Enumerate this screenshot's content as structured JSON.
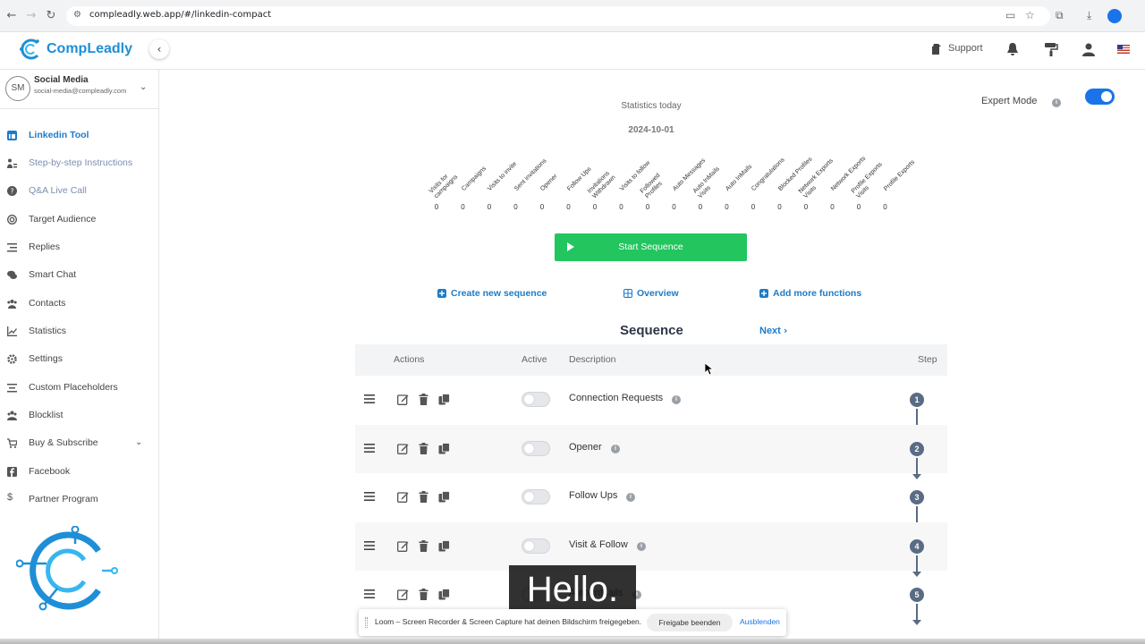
{
  "browser": {
    "url": "compleadly.web.app/#/linkedin-compact"
  },
  "header": {
    "logo_text": "CompLeadly",
    "support_label": "Support"
  },
  "user": {
    "initials": "SM",
    "name": "Social Media",
    "email": "social-media@compleadly.com"
  },
  "sidebar": {
    "items": [
      {
        "label": "Linkedin Tool",
        "icon": "linkedin-icon",
        "state": "active"
      },
      {
        "label": "Step-by-step Instructions",
        "icon": "person-steps-icon",
        "state": "muted"
      },
      {
        "label": "Q&A Live Call",
        "icon": "question-icon",
        "state": "muted"
      },
      {
        "label": "Target Audience",
        "icon": "target-icon",
        "state": "normal"
      },
      {
        "label": "Replies",
        "icon": "replies-icon",
        "state": "normal"
      },
      {
        "label": "Smart Chat",
        "icon": "chat-icon",
        "state": "normal"
      },
      {
        "label": "Contacts",
        "icon": "contacts-icon",
        "state": "normal"
      },
      {
        "label": "Statistics",
        "icon": "chart-icon",
        "state": "normal"
      },
      {
        "label": "Settings",
        "icon": "gear-icon",
        "state": "normal"
      },
      {
        "label": "Custom Placeholders",
        "icon": "placeholder-icon",
        "state": "normal"
      },
      {
        "label": "Blocklist",
        "icon": "blocklist-icon",
        "state": "normal"
      },
      {
        "label": "Buy & Subscribe",
        "icon": "cart-icon",
        "state": "normal"
      },
      {
        "label": "Facebook",
        "icon": "facebook-icon",
        "state": "normal"
      },
      {
        "label": "Partner Program",
        "icon": "dollar-icon",
        "state": "normal"
      }
    ]
  },
  "stats": {
    "title": "Statistics today",
    "date": "2024-10-01",
    "items": [
      {
        "label": "Visits for campaigns",
        "value": "0"
      },
      {
        "label": "Campaigns",
        "value": "0"
      },
      {
        "label": "Visits to invite",
        "value": "0"
      },
      {
        "label": "Sent invitations",
        "value": "0"
      },
      {
        "label": "Opener",
        "value": "0"
      },
      {
        "label": "Follow Ups",
        "value": "0"
      },
      {
        "label": "Invitations Withdrawn",
        "value": "0"
      },
      {
        "label": "Visits to follow",
        "value": "0"
      },
      {
        "label": "Followed Profiles",
        "value": "0"
      },
      {
        "label": "Auto Messages",
        "value": "0"
      },
      {
        "label": "Auto InMails Visits",
        "value": "0"
      },
      {
        "label": "Auto InMails",
        "value": "0"
      },
      {
        "label": "Congratulations",
        "value": "0"
      },
      {
        "label": "Blocked Profiles",
        "value": "0"
      },
      {
        "label": "Network Exports Visits",
        "value": "0"
      },
      {
        "label": "Network Exports",
        "value": "0"
      },
      {
        "label": "Profile Exports Visits",
        "value": "0"
      },
      {
        "label": "Profile Exports",
        "value": "0"
      }
    ]
  },
  "expert_mode": {
    "label": "Expert Mode",
    "enabled": true
  },
  "start_button": "Start Sequence",
  "links": {
    "create": "Create new sequence",
    "overview": "Overview",
    "add_more": "Add more functions"
  },
  "sequence": {
    "title": "Sequence",
    "next": "Next",
    "columns": {
      "actions": "Actions",
      "active": "Active",
      "description": "Description",
      "step": "Step"
    },
    "rows": [
      {
        "description": "Connection Requests",
        "step": "1",
        "active": false
      },
      {
        "description": "Opener",
        "step": "2",
        "active": false
      },
      {
        "description": "Follow Ups",
        "step": "3",
        "active": false
      },
      {
        "description": "Visit & Follow",
        "step": "4",
        "active": false
      },
      {
        "description": "Auto InMails",
        "step": "5",
        "active": false
      }
    ]
  },
  "overlay": {
    "caption": "Hello.",
    "loom_text": "Loom – Screen Recorder & Screen Capture hat deinen Bildschirm freigegeben.",
    "loom_stop": "Freigabe beenden",
    "loom_hide": "Ausblenden"
  },
  "colors": {
    "brand": "#1e8fd6",
    "start_button": "#22c55e",
    "step_badge": "#5a6b84",
    "link": "#1e7bc8"
  }
}
